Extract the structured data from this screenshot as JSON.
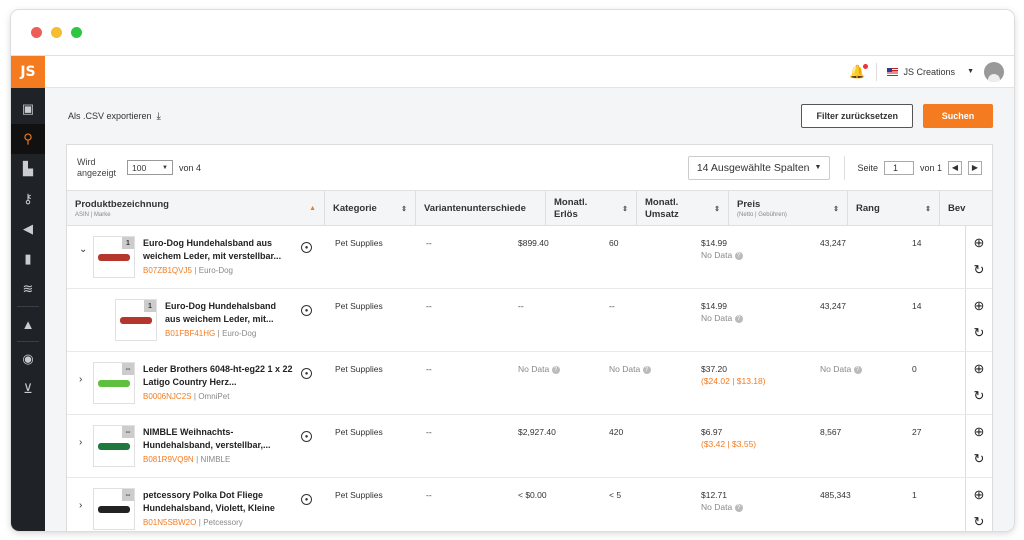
{
  "window": {
    "dot_colors": [
      "#ed5f56",
      "#f5bd2f",
      "#2cc842"
    ]
  },
  "brand": {
    "logo": "JS",
    "accent": "#f47b20"
  },
  "sidebar": {
    "items": [
      "briefcase-icon",
      "search-icon",
      "building-icon",
      "key-icon",
      "megaphone-icon",
      "bar-chart-icon",
      "academy-icon",
      "graduation-cap-icon",
      "chrome-icon",
      "cart-icon"
    ]
  },
  "topbar": {
    "account": "JS Creations",
    "caret": "▼"
  },
  "actions": {
    "export_label": "Als .CSV exportieren",
    "reset_label": "Filter zurücksetzen",
    "search_label": "Suchen"
  },
  "controls": {
    "shown_label": "Wird angezeigt",
    "per_page": "100",
    "of_label": "von 4",
    "columns_label": "14 Ausgewählte Spalten",
    "page_label": "Seite",
    "page_value": "1",
    "page_of": "von 1"
  },
  "columns": {
    "product": "Produktbezeichnung",
    "product_sub": "ASIN | Marke",
    "category": "Kategorie",
    "variants": "Variantenunterschiede",
    "revenue": "Monatl. Erlös",
    "units": "Monatl. Umsatz",
    "price": "Preis",
    "price_sub": "(Netto | Gebühren)",
    "rank": "Rang",
    "reviews": "Bev"
  },
  "rows": [
    {
      "badge": "1",
      "name": "Euro-Dog Hundehalsband aus weichem Leder, mit verstellbar...",
      "asin": "B07ZB1QVJ5",
      "brand": "Euro-Dog",
      "category": "Pet Supplies",
      "variants": "--",
      "revenue": "$899.40",
      "units": "60",
      "price": "$14.99",
      "price_sub": "No Data",
      "rank": "43,247",
      "reviews": "14",
      "collar": "#b5362c",
      "expand": "⌄"
    },
    {
      "badge": "1",
      "name": "Euro-Dog Hundehalsband aus weichem Leder, mit...",
      "asin": "B01FBF41HG",
      "brand": "Euro-Dog",
      "category": "Pet Supplies",
      "variants": "--",
      "revenue": "--",
      "units": "--",
      "price": "$14.99",
      "price_sub": "No Data",
      "rank": "43,247",
      "reviews": "14",
      "collar": "#b5362c",
      "expand": ""
    },
    {
      "badge": "--",
      "name": "Leder Brothers 6048-ht-eg22 1 x 22 Latigo Country Herz...",
      "asin": "B0006NJC2S",
      "brand": "OmniPet",
      "category": "Pet Supplies",
      "variants": "--",
      "revenue": "No Data",
      "units": "No Data",
      "price": "$37.20",
      "price_sub": "($24.02 | $13.18)",
      "rank": "No Data",
      "reviews": "0",
      "collar": "#5fbf3f",
      "expand": "›"
    },
    {
      "badge": "--",
      "name": "NIMBLE Weihnachts-Hundehalsband, verstellbar,...",
      "asin": "B081R9VQ9N",
      "brand": "NIMBLE",
      "category": "Pet Supplies",
      "variants": "--",
      "revenue": "$2,927.40",
      "units": "420",
      "price": "$6.97",
      "price_sub": "($3.42 | $3.55)",
      "rank": "8,567",
      "reviews": "27",
      "collar": "#1d7a3c",
      "expand": "›"
    },
    {
      "badge": "--",
      "name": "petcessory Polka Dot Fliege Hundehalsband, Violett, Kleine",
      "asin": "B01N5SBW2O",
      "brand": "Petcessory",
      "category": "Pet Supplies",
      "variants": "--",
      "revenue": "< $0.00",
      "units": "< 5",
      "price": "$12.71",
      "price_sub": "No Data",
      "rank": "485,343",
      "reviews": "1",
      "collar": "#222222",
      "expand": "›"
    }
  ]
}
